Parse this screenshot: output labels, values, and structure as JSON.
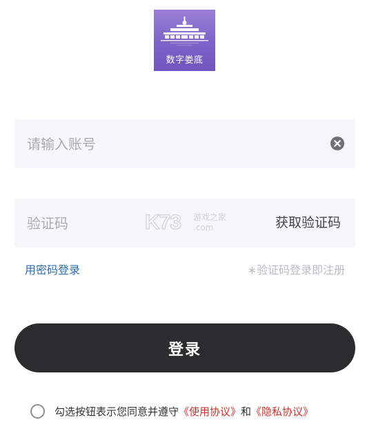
{
  "logo": {
    "text": "数字娄底",
    "icon": "building-icon",
    "colors": {
      "top": "#9b7fd6",
      "bottom": "#6f55bd"
    }
  },
  "account": {
    "placeholder": "请输入账号",
    "value": "",
    "clear_icon": "clear-circle-icon"
  },
  "code": {
    "placeholder": "验证码",
    "value": "",
    "get_code_label": "获取验证码"
  },
  "watermark": {
    "brand": "K73",
    "sub1": "游戏之家",
    "sub2": ".com"
  },
  "links": {
    "password_login": "用密码登录",
    "hint": "∗验证码登录即注册"
  },
  "login_button": {
    "label": "登录",
    "color": "#2c2c2e"
  },
  "agreement": {
    "checked": false,
    "prefix": "勾选按钮表示您同意并遵守",
    "user_agreement": "《使用协议》",
    "conjunction": "和",
    "privacy_agreement": "《隐私协议》",
    "link_color": "#c8322c"
  }
}
